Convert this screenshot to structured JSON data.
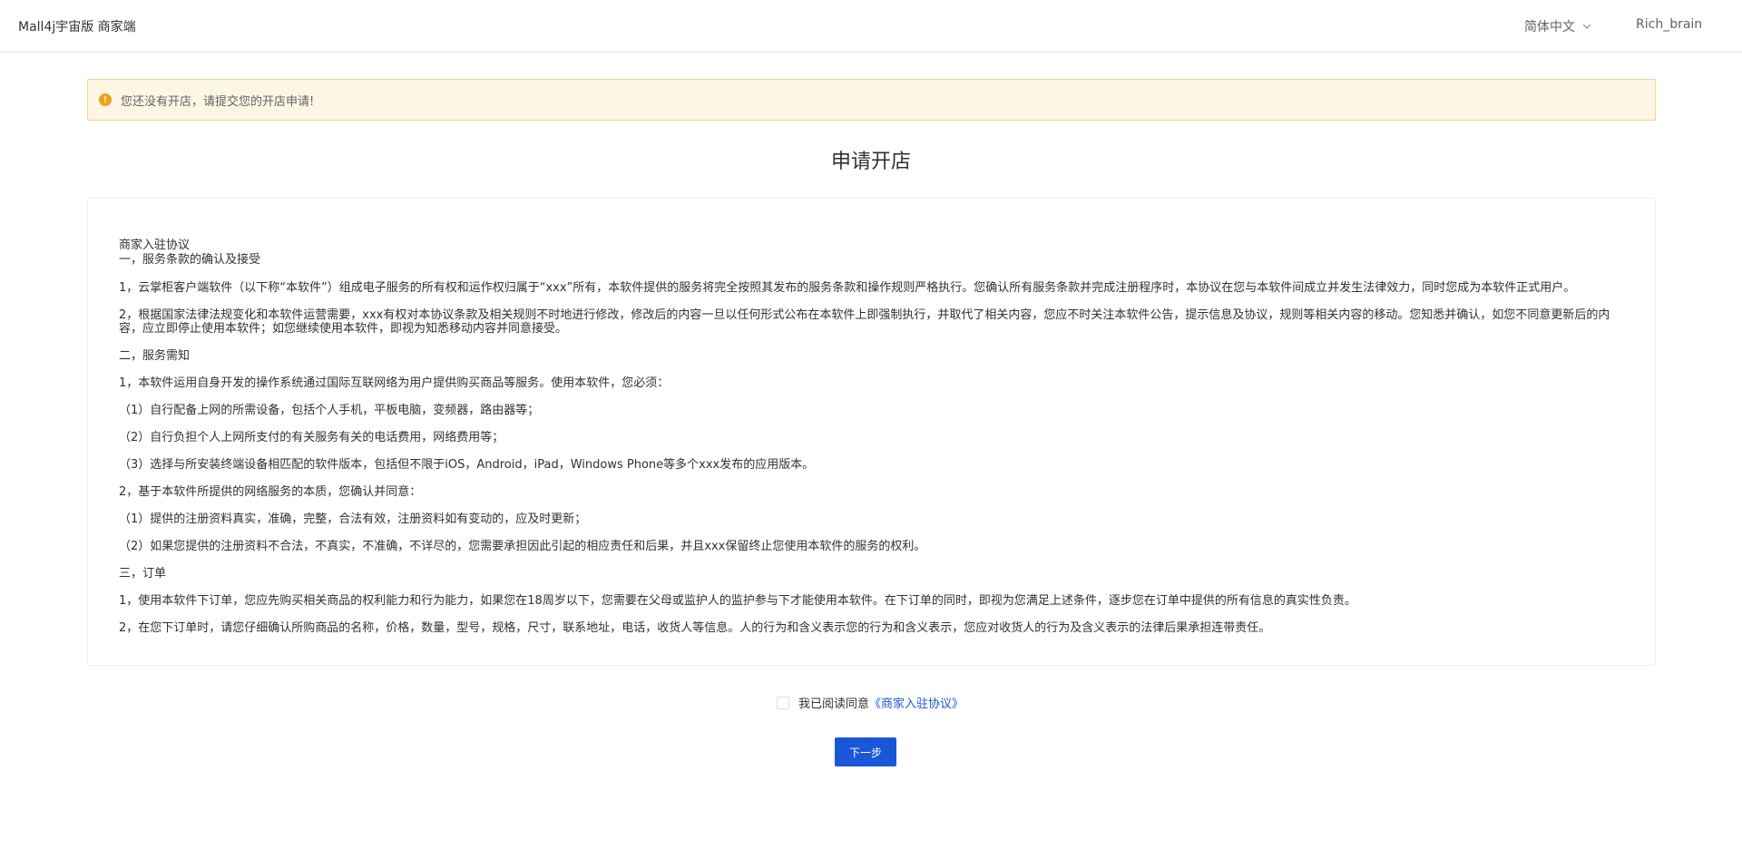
{
  "header": {
    "brand": "Mall4j宇宙版 商家端",
    "language": "简体中文",
    "username": "Rich_brain"
  },
  "notice": {
    "text": "您还没有开店，请提交您的开店申请!"
  },
  "page_title": "申请开店",
  "agreement": {
    "title": "商家入驻协议",
    "section1_heading": "一，服务条款的确认及接受",
    "s1_p1": "1，云掌柜客户端软件（以下称“本软件”）组成电子服务的所有权和运作权归属于“xxx”所有，本软件提供的服务将完全按照其发布的服务条款和操作规则严格执行。您确认所有服务条款并完成注册程序时，本协议在您与本软件间成立并发生法律效力，同时您成为本软件正式用户。",
    "s1_p2": "2，根据国家法律法规变化和本软件运营需要，xxx有权对本协议条款及相关规则不时地进行修改，修改后的内容一旦以任何形式公布在本软件上即强制执行，并取代了相关内容，您应不时关注本软件公告，提示信息及协议，规则等相关内容的移动。您知悉并确认，如您不同意更新后的内容，应立即停止使用本软件；如您继续使用本软件，即视为知悉移动内容并同意接受。",
    "section2_heading": "二，服务需知",
    "s2_p1": "1，本软件运用自身开发的操作系统通过国际互联网络为用户提供购买商品等服务。使用本软件，您必须：",
    "s2_p2": "（1）自行配备上网的所需设备，包括个人手机，平板电脑，变频器，路由器等；",
    "s2_p3": "（2）自行负担个人上网所支付的有关服务有关的电话费用，网络费用等；",
    "s2_p4": "（3）选择与所安装终端设备相匹配的软件版本，包括但不限于iOS，Android，iPad，Windows Phone等多个xxx发布的应用版本。",
    "s2_p5": "2，基于本软件所提供的网络服务的本质，您确认并同意：",
    "s2_p6": "（1）提供的注册资料真实，准确，完整，合法有效，注册资料如有变动的，应及时更新；",
    "s2_p7": "（2）如果您提供的注册资料不合法，不真实，不准确，不详尽的，您需要承担因此引起的相应责任和后果，并且xxx保留终止您使用本软件的服务的权利。",
    "section3_heading": "三，订单",
    "s3_p1": "1，使用本软件下订单，您应先购买相关商品的权利能力和行为能力，如果您在18周岁以下，您需要在父母或监护人的监护参与下才能使用本软件。在下订单的同时，即视为您满足上述条件，逐步您在订单中提供的所有信息的真实性负责。",
    "s3_p2": "2，在您下订单时，请您仔细确认所购商品的名称，价格，数量，型号，规格，尺寸，联系地址，电话，收货人等信息。人的行为和含义表示您的行为和含义表示，您应对收货人的行为及含义表示的法律后果承担连带责任。"
  },
  "agree": {
    "prefix": "我已阅读同意",
    "link": "《商家入驻协议》",
    "checked": false
  },
  "next_button": "下一步",
  "colors": {
    "primary": "#1a57d8",
    "warning": "#f0a020",
    "notice_bg": "#fdf6e4"
  }
}
